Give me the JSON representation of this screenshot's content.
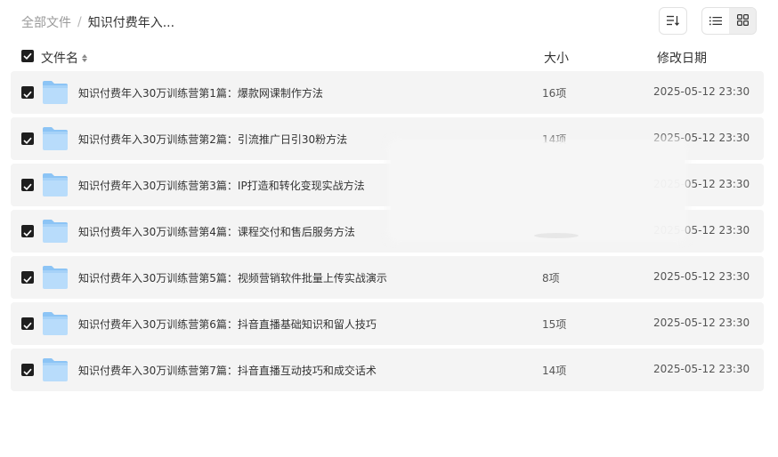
{
  "breadcrumb": {
    "root": "全部文件",
    "separator": "/",
    "current": "知识付费年入..."
  },
  "toolbar": {
    "sort_icon": "sort-descending-icon",
    "list_view_icon": "list-view-icon",
    "grid_view_icon": "grid-view-icon",
    "active_view": "list"
  },
  "table": {
    "columns": {
      "name": "文件名",
      "size": "大小",
      "date": "修改日期"
    },
    "all_selected": true,
    "rows": [
      {
        "name": "知识付费年入30万训练营第1篇：爆款网课制作方法",
        "size": "16项",
        "date": "2025-05-12 23:30",
        "selected": true
      },
      {
        "name": "知识付费年入30万训练营第2篇：引流推广日引30粉方法",
        "size": "14项",
        "date": "2025-05-12 23:30",
        "selected": true
      },
      {
        "name": "知识付费年入30万训练营第3篇：IP打造和转化变现实战方法",
        "size": "",
        "date": "2025-05-12 23:30",
        "selected": true
      },
      {
        "name": "知识付费年入30万训练营第4篇：课程交付和售后服务方法",
        "size": "",
        "date": "2025-05-12 23:30",
        "selected": true
      },
      {
        "name": "知识付费年入30万训练营第5篇：视频营销软件批量上传实战演示",
        "size": "8项",
        "date": "2025-05-12 23:30",
        "selected": true
      },
      {
        "name": "知识付费年入30万训练营第6篇：抖音直播基础知识和留人技巧",
        "size": "15项",
        "date": "2025-05-12 23:30",
        "selected": true
      },
      {
        "name": "知识付费年入30万训练营第7篇：抖音直播互动技巧和成交话术",
        "size": "14项",
        "date": "2025-05-12 23:30",
        "selected": true
      }
    ]
  },
  "colors": {
    "row_bg": "#f4f4f4",
    "checkbox": "#1f1f1f",
    "folder_top": "#8cc4f5",
    "folder_body": "#b8dcfb"
  }
}
